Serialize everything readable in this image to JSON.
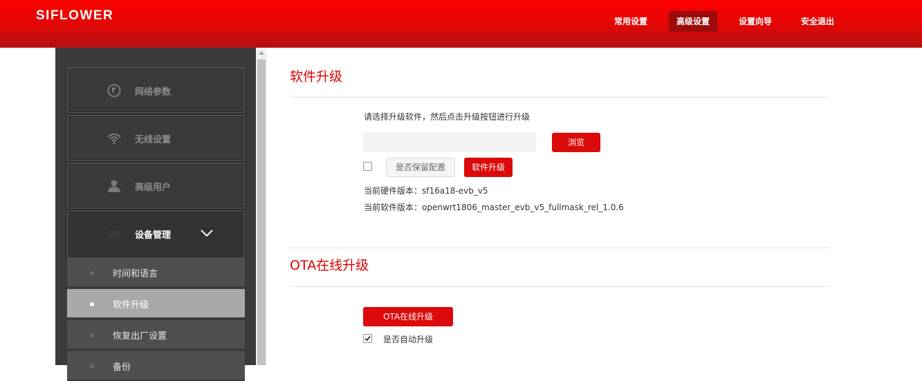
{
  "header": {
    "logo": "SIFLOWER",
    "nav": [
      {
        "label": "常用设置",
        "active": false
      },
      {
        "label": "高级设置",
        "active": true
      },
      {
        "label": "设置向导",
        "active": false
      },
      {
        "label": "安全退出",
        "active": false
      }
    ]
  },
  "sidebar": {
    "items": [
      {
        "label": "网络参数",
        "icon": "globe-icon"
      },
      {
        "label": "无线设置",
        "icon": "wifi-icon"
      },
      {
        "label": "高级用户",
        "icon": "user-icon"
      },
      {
        "label": "设备管理",
        "icon": "device-icon",
        "expanded": true
      }
    ],
    "sub_items": [
      {
        "label": "时间和语言",
        "active": false
      },
      {
        "label": "软件升级",
        "active": true
      },
      {
        "label": "恢复出厂设置",
        "active": false
      },
      {
        "label": "备份",
        "active": false
      }
    ]
  },
  "upgrade": {
    "title": "软件升级",
    "instruction": "请选择升级软件，然后点击升级按钮进行升级",
    "file_value": "",
    "browse_label": "浏览",
    "keep_config_label": "是否保留配置",
    "keep_config_checked": false,
    "upgrade_label": "软件升级",
    "hw_version_label": "当前硬件版本：",
    "hw_version": "sf16a18-evb_v5",
    "sw_version_label": "当前软件版本：",
    "sw_version": "openwrt1806_master_evb_v5_fullmask_rel_1.0.6"
  },
  "ota": {
    "title": "OTA在线升级",
    "button_label": "OTA在线升级",
    "auto_label": "是否自动升级",
    "auto_checked": true
  },
  "colors": {
    "brand_red": "#dc0a0a",
    "header_active": "#9d0b0b",
    "sidebar_bg": "#3b3b3b",
    "sub_active": "#a9a9a9"
  }
}
